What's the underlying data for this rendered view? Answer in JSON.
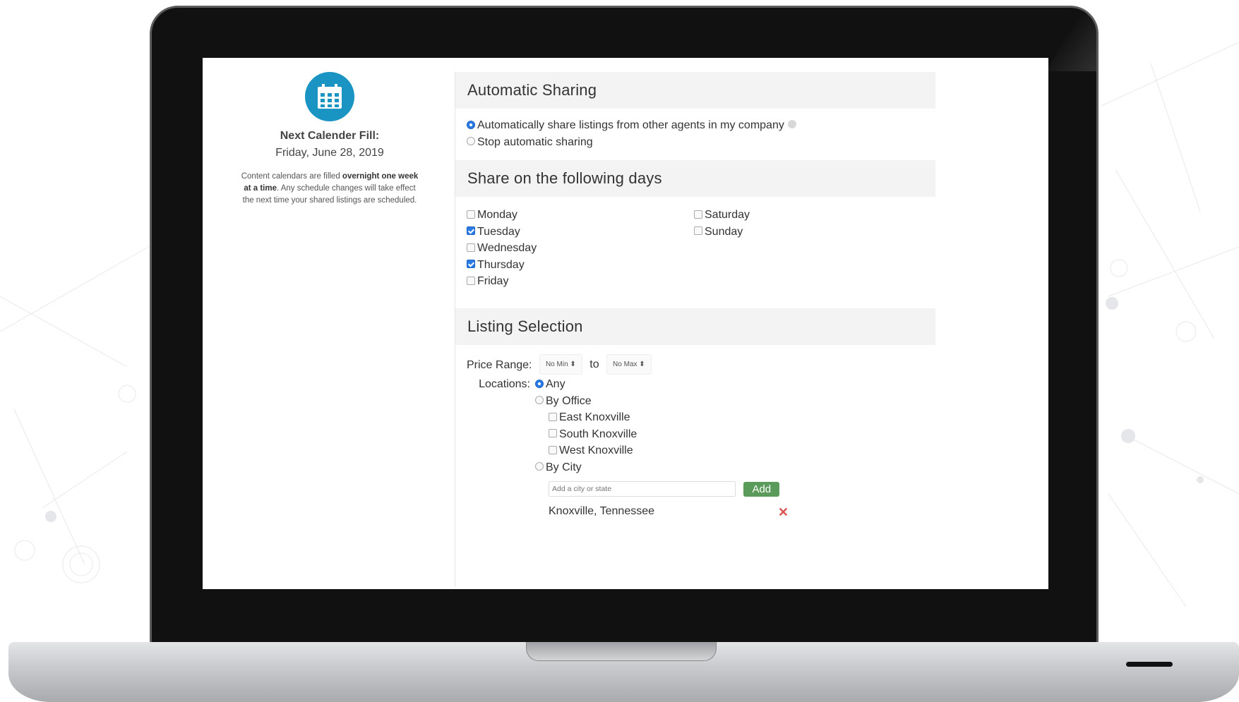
{
  "left_panel": {
    "calendar_icon": "calendar-icon",
    "next_fill_title": "Next Calender Fill:",
    "next_fill_date": "Friday, June 28, 2019",
    "note_part1": "Content calendars are filled ",
    "note_bold1": "overnight one week at a time",
    "note_part2": ". Any schedule changes will take effect the next time your shared listings are scheduled."
  },
  "automatic_sharing": {
    "title": "Automatic Sharing",
    "options": [
      {
        "label": "Automatically share listings from other agents in my company",
        "selected": true
      },
      {
        "label": "Stop automatic sharing",
        "selected": false
      }
    ]
  },
  "share_days": {
    "title": "Share on the following days",
    "col1": [
      {
        "label": "Monday",
        "checked": false
      },
      {
        "label": "Tuesday",
        "checked": true
      },
      {
        "label": "Wednesday",
        "checked": false
      },
      {
        "label": "Thursday",
        "checked": true
      },
      {
        "label": "Friday",
        "checked": false
      }
    ],
    "col2": [
      {
        "label": "Saturday",
        "checked": false
      },
      {
        "label": "Sunday",
        "checked": false
      }
    ]
  },
  "listing_selection": {
    "title": "Listing Selection",
    "price_range_label": "Price Range:",
    "min_value": "No Min ⬍",
    "to_label": "to",
    "max_value": "No Max ⬍",
    "locations_label": "Locations:",
    "any_label": "Any",
    "by_office_label": "By Office",
    "offices": [
      "East Knoxville",
      "South Knoxville",
      "West Knoxville"
    ],
    "by_city_label": "By City",
    "city_placeholder": "Add a city or state",
    "add_button": "Add",
    "cities": [
      {
        "name": "Knoxville, Tennessee",
        "remove": "✕"
      }
    ]
  }
}
